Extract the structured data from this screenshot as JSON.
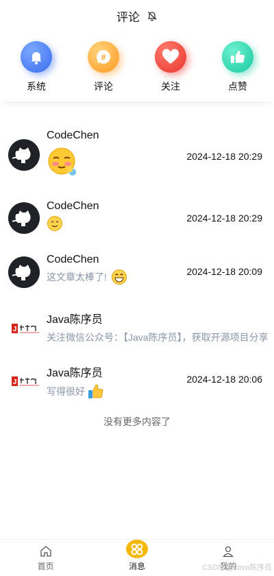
{
  "header": {
    "title": "评论",
    "bell_icon": "bell-off-icon"
  },
  "categories": [
    {
      "label": "系统",
      "icon": "bell-icon",
      "color": "#3a6df0"
    },
    {
      "label": "评论",
      "icon": "hash-chat-icon",
      "color": "#ff9a1f"
    },
    {
      "label": "关注",
      "icon": "heart-icon",
      "color": "#e8332a"
    },
    {
      "label": "点赞",
      "icon": "thumbs-up-icon",
      "color": "#19c9a0"
    }
  ],
  "messages": [
    {
      "user": "CodeChen",
      "avatar": "github-octocat-avatar",
      "text": "",
      "emoji": "shy-face-emoji",
      "time": "2024-12-18 20:29"
    },
    {
      "user": "CodeChen",
      "avatar": "github-octocat-avatar",
      "text": "",
      "emoji": "smile-emoji",
      "time": "2024-12-18 20:29"
    },
    {
      "user": "CodeChen",
      "avatar": "github-octocat-avatar",
      "text": "这文章太棒了!",
      "emoji": "grin-emoji",
      "time": "2024-12-18 20:09"
    },
    {
      "user": "Java陈序员",
      "avatar": "java-logo-avatar",
      "text": "关注微信公众号：【Java陈序员】，获取开源项目分享",
      "emoji": "",
      "time": ""
    },
    {
      "user": "Java陈序员",
      "avatar": "java-logo-avatar",
      "text": "写得很好",
      "emoji": "thumbs-up-emoji",
      "time": "2024-12-18 20:06"
    }
  ],
  "no_more": "没有更多内容了",
  "tabbar": [
    {
      "label": "首页",
      "icon": "home-icon",
      "active": false
    },
    {
      "label": "消息",
      "icon": "message-clover-icon",
      "active": true
    },
    {
      "label": "我的",
      "icon": "person-icon",
      "active": false
    }
  ],
  "watermark": "CSDN @Java陈序员"
}
